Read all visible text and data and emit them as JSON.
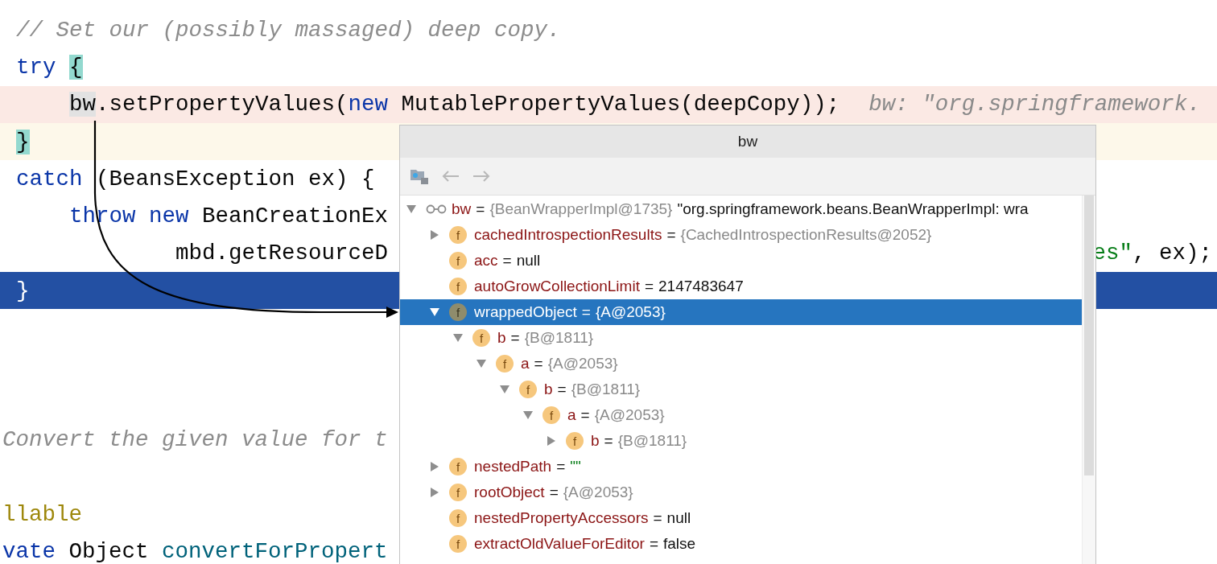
{
  "editor": {
    "lines": [
      {
        "kind": "code",
        "tokens": [
          {
            "kind": "comment",
            "text": "// Set our (possibly massaged) deep copy."
          }
        ]
      },
      {
        "kind": "code",
        "tokens": [
          {
            "kind": "keyword",
            "text": "try"
          },
          {
            "kind": "brace",
            "text": "{"
          }
        ],
        "children": [
          {
            "kind": "breakpoint",
            "tokens": [
              {
                "kind": "usage",
                "text": "bw"
              },
              {
                "kind": "plain",
                "text": ".setPropertyValues("
              },
              {
                "kind": "keyword",
                "text": "new"
              },
              {
                "kind": "plain",
                "text": " MutablePropertyValues(deepCopy));"
              }
            ],
            "hint": "bw: \"org.springframework."
          }
        ]
      },
      {
        "kind": "caret",
        "tokens": [
          {
            "kind": "brace",
            "text": "}"
          }
        ]
      },
      {
        "kind": "code",
        "tokens": [
          {
            "kind": "keyword",
            "text": "catch"
          },
          {
            "kind": "plain",
            "text": " (BeansException ex) {"
          }
        ],
        "children": [
          {
            "kind": "code",
            "tokens": [
              {
                "kind": "keyword",
                "text": "throw new"
              },
              {
                "kind": "plain",
                "text": " BeanCreationEx"
              }
            ],
            "children": [
              {
                "kind": "continuation",
                "tokens": [
                  {
                    "kind": "plain",
                    "text": "mbd.getResourceD"
                  }
                ],
                "right_tokens": [
                  {
                    "kind": "string",
                    "text": "es\""
                  },
                  {
                    "kind": "plain",
                    "text": ", ex);"
                  }
                ]
              }
            ]
          }
        ]
      },
      {
        "kind": "execution",
        "tokens": [
          {
            "kind": "plain",
            "text": "}"
          }
        ]
      },
      {
        "kind": "blank"
      },
      {
        "kind": "blank"
      },
      {
        "kind": "blank"
      },
      {
        "kind": "cut",
        "tokens": [
          {
            "kind": "comment",
            "text": "Convert the given value for t"
          }
        ]
      },
      {
        "kind": "blank"
      },
      {
        "kind": "cut",
        "tokens": [
          {
            "kind": "annotation",
            "text": "llable"
          }
        ]
      },
      {
        "kind": "cut",
        "tokens": [
          {
            "kind": "keyword",
            "text": "vate"
          },
          {
            "kind": "plain",
            "text": " Object "
          },
          {
            "kind": "method",
            "text": "convertForPropert"
          }
        ]
      }
    ]
  },
  "popup": {
    "title": "bw",
    "tree": [
      {
        "kind": "watch",
        "name": "bw",
        "op": "=",
        "value": {
          "kind": "ref",
          "text": "{BeanWrapperImpl@1735}"
        },
        "description": "\"org.springframework.beans.BeanWrapperImpl: wra",
        "expanded": true,
        "selected": false,
        "children": [
          {
            "kind": "object",
            "badge": "f",
            "name": "cachedIntrospectionResults",
            "op": "=",
            "value": {
              "kind": "ref",
              "text": "{CachedIntrospectionResults@2052}"
            },
            "expanded": false,
            "selected": false
          },
          {
            "kind": "value",
            "badge": "f",
            "name": "acc",
            "op": "=",
            "value": {
              "kind": "plain",
              "text": "null"
            },
            "selected": false
          },
          {
            "kind": "value",
            "badge": "f",
            "name": "autoGrowCollectionLimit",
            "op": "=",
            "value": {
              "kind": "plain",
              "text": "2147483647"
            },
            "selected": false
          },
          {
            "kind": "object",
            "badge": "f",
            "name": "wrappedObject",
            "op": "=",
            "value": {
              "kind": "ref",
              "text": "{A@2053}"
            },
            "expanded": true,
            "selected": true,
            "children": [
              {
                "kind": "object",
                "badge": "f",
                "name": "b",
                "op": "=",
                "value": {
                  "kind": "ref",
                  "text": "{B@1811}"
                },
                "expanded": true,
                "selected": false,
                "children": [
                  {
                    "kind": "object",
                    "badge": "f",
                    "name": "a",
                    "op": "=",
                    "value": {
                      "kind": "ref",
                      "text": "{A@2053}"
                    },
                    "expanded": true,
                    "selected": false,
                    "children": [
                      {
                        "kind": "object",
                        "badge": "f",
                        "name": "b",
                        "op": "=",
                        "value": {
                          "kind": "ref",
                          "text": "{B@1811}"
                        },
                        "expanded": true,
                        "selected": false,
                        "children": [
                          {
                            "kind": "object",
                            "badge": "f",
                            "name": "a",
                            "op": "=",
                            "value": {
                              "kind": "ref",
                              "text": "{A@2053}"
                            },
                            "expanded": true,
                            "selected": false,
                            "children": [
                              {
                                "kind": "object",
                                "badge": "f",
                                "name": "b",
                                "op": "=",
                                "value": {
                                  "kind": "ref",
                                  "text": "{B@1811}"
                                },
                                "expanded": false,
                                "selected": false
                              }
                            ]
                          }
                        ]
                      }
                    ]
                  }
                ]
              }
            ]
          },
          {
            "kind": "object",
            "badge": "f",
            "name": "nestedPath",
            "op": "=",
            "value": {
              "kind": "string",
              "text": "\"\""
            },
            "expanded": false,
            "selected": false
          },
          {
            "kind": "object",
            "badge": "f",
            "name": "rootObject",
            "op": "=",
            "value": {
              "kind": "ref",
              "text": "{A@2053}"
            },
            "expanded": false,
            "selected": false
          },
          {
            "kind": "value",
            "badge": "f",
            "name": "nestedPropertyAccessors",
            "op": "=",
            "value": {
              "kind": "plain",
              "text": "null"
            },
            "selected": false
          },
          {
            "kind": "value",
            "badge": "f",
            "name": "extractOldValueForEditor",
            "op": "=",
            "value": {
              "kind": "plain",
              "text": "false"
            },
            "selected": false
          }
        ]
      }
    ]
  }
}
